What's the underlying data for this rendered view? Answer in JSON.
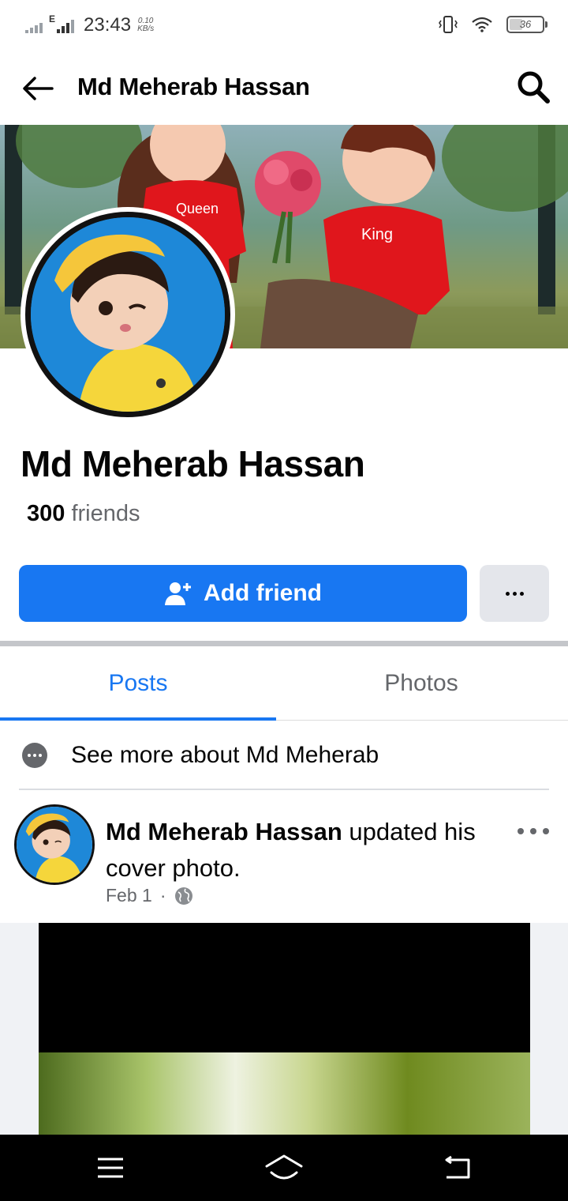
{
  "status_bar": {
    "network_type": "E",
    "time": "23:43",
    "speed_value": "0.10",
    "speed_unit": "KB/s",
    "battery": "36"
  },
  "header": {
    "title": "Md Meherab Hassan",
    "back_icon": "arrow-left-icon",
    "search_icon": "search-icon"
  },
  "cover": {
    "shirt_left": "Queen",
    "shirt_right": "King"
  },
  "profile": {
    "name": "Md Meherab Hassan",
    "friends_count": "300",
    "friends_label": "friends"
  },
  "actions": {
    "add_friend_label": "Add friend",
    "add_friend_icon": "add-person-icon",
    "more_icon": "more-dots-icon"
  },
  "tabs": [
    {
      "label": "Posts",
      "active": true
    },
    {
      "label": "Photos",
      "active": false
    }
  ],
  "see_more": {
    "label": "See more about Md Meherab"
  },
  "post": {
    "author": "Md Meherab Hassan",
    "action": "updated his cover photo.",
    "date": "Feb 1",
    "separator": "·",
    "privacy_icon": "globe-icon"
  },
  "colors": {
    "accent": "#1877f2",
    "secondary_text": "#65676b",
    "button_gray": "#e4e6eb"
  }
}
